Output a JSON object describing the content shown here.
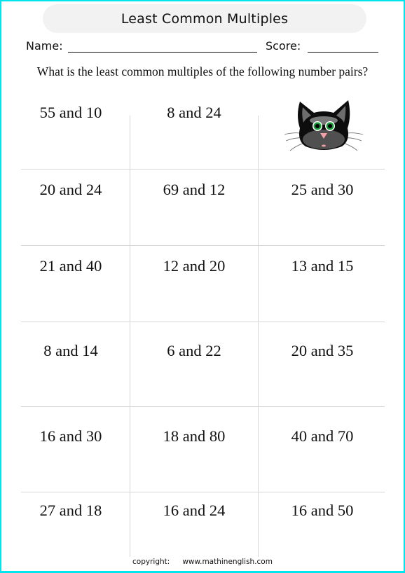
{
  "worksheet": {
    "title": "Least Common Multiples",
    "name_label": "Name:",
    "score_label": "Score:",
    "instructions": "What is the least common multiples of the following number pairs?",
    "problems": [
      [
        "55 and 10",
        "8 and 24",
        null
      ],
      [
        "20 and 24",
        "69 and 12",
        "25 and 30"
      ],
      [
        "21 and 40",
        "12 and 20",
        "13 and 15"
      ],
      [
        "8 and 14",
        "6 and 22",
        "20 and 35"
      ],
      [
        "16 and 30",
        "18 and 80",
        "40 and 70"
      ],
      [
        "27 and 18",
        "16 and 24",
        "16 and 50"
      ]
    ],
    "illustration": "black-cat-face",
    "footer": {
      "copyright_label": "copyright:",
      "website": "www.mathinenglish.com"
    }
  },
  "colors": {
    "frame_border": "#00e5ee",
    "title_background": "#f2f2f2",
    "grid_lines": "#d6d6d6",
    "cat_eyes": "#1a9a3a",
    "cat_nose": "#f4a0a8"
  }
}
